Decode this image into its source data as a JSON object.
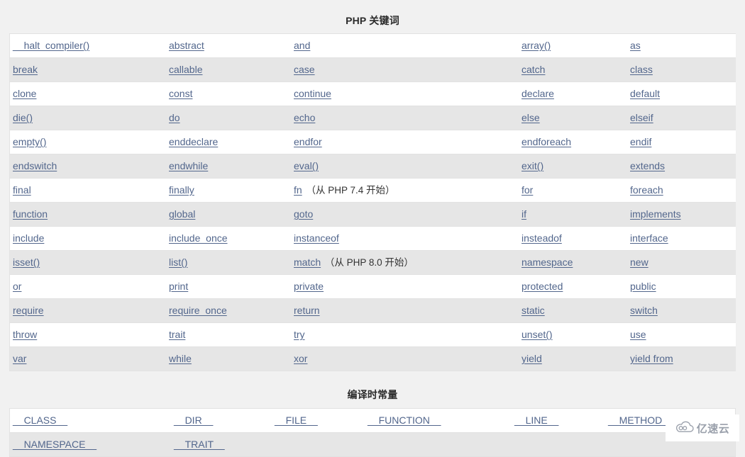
{
  "page": {
    "background_color": "#f1f1f1",
    "link_color": "#52668c",
    "alt_row_color": "#e6e6e6",
    "row_color": "#ffffff",
    "border_color": "#e2e2e2"
  },
  "keywords_section": {
    "title": "PHP 关键词",
    "rows": [
      [
        {
          "label": "__halt_compiler()",
          "note": ""
        },
        {
          "label": "abstract",
          "note": ""
        },
        {
          "label": "and",
          "note": ""
        },
        {
          "label": "array()",
          "note": ""
        },
        {
          "label": "as",
          "note": ""
        }
      ],
      [
        {
          "label": "break",
          "note": ""
        },
        {
          "label": "callable",
          "note": ""
        },
        {
          "label": "case",
          "note": ""
        },
        {
          "label": "catch",
          "note": ""
        },
        {
          "label": "class",
          "note": ""
        }
      ],
      [
        {
          "label": "clone",
          "note": ""
        },
        {
          "label": "const",
          "note": ""
        },
        {
          "label": "continue",
          "note": ""
        },
        {
          "label": "declare",
          "note": ""
        },
        {
          "label": "default",
          "note": ""
        }
      ],
      [
        {
          "label": "die()",
          "note": ""
        },
        {
          "label": "do",
          "note": ""
        },
        {
          "label": "echo",
          "note": ""
        },
        {
          "label": "else",
          "note": ""
        },
        {
          "label": "elseif",
          "note": ""
        }
      ],
      [
        {
          "label": "empty()",
          "note": ""
        },
        {
          "label": "enddeclare",
          "note": ""
        },
        {
          "label": "endfor",
          "note": ""
        },
        {
          "label": "endforeach",
          "note": ""
        },
        {
          "label": "endif",
          "note": ""
        }
      ],
      [
        {
          "label": "endswitch",
          "note": ""
        },
        {
          "label": "endwhile",
          "note": ""
        },
        {
          "label": "eval()",
          "note": ""
        },
        {
          "label": "exit()",
          "note": ""
        },
        {
          "label": "extends",
          "note": ""
        }
      ],
      [
        {
          "label": "final",
          "note": ""
        },
        {
          "label": "finally",
          "note": ""
        },
        {
          "label": "fn",
          "note": "（从 PHP 7.4 开始）"
        },
        {
          "label": "for",
          "note": ""
        },
        {
          "label": "foreach",
          "note": ""
        }
      ],
      [
        {
          "label": "function",
          "note": ""
        },
        {
          "label": "global",
          "note": ""
        },
        {
          "label": "goto",
          "note": ""
        },
        {
          "label": "if",
          "note": ""
        },
        {
          "label": "implements",
          "note": ""
        }
      ],
      [
        {
          "label": "include",
          "note": ""
        },
        {
          "label": "include_once",
          "note": ""
        },
        {
          "label": "instanceof",
          "note": ""
        },
        {
          "label": "insteadof",
          "note": ""
        },
        {
          "label": "interface",
          "note": ""
        }
      ],
      [
        {
          "label": "isset()",
          "note": ""
        },
        {
          "label": "list()",
          "note": ""
        },
        {
          "label": "match",
          "note": "（从 PHP 8.0 开始）"
        },
        {
          "label": "namespace",
          "note": ""
        },
        {
          "label": "new",
          "note": ""
        }
      ],
      [
        {
          "label": "or",
          "note": ""
        },
        {
          "label": "print",
          "note": ""
        },
        {
          "label": "private",
          "note": ""
        },
        {
          "label": "protected",
          "note": ""
        },
        {
          "label": "public",
          "note": ""
        }
      ],
      [
        {
          "label": "require",
          "note": ""
        },
        {
          "label": "require_once",
          "note": ""
        },
        {
          "label": "return",
          "note": ""
        },
        {
          "label": "static",
          "note": ""
        },
        {
          "label": "switch",
          "note": ""
        }
      ],
      [
        {
          "label": "throw",
          "note": ""
        },
        {
          "label": "trait",
          "note": ""
        },
        {
          "label": "try",
          "note": ""
        },
        {
          "label": "unset()",
          "note": ""
        },
        {
          "label": "use",
          "note": ""
        }
      ],
      [
        {
          "label": "var",
          "note": ""
        },
        {
          "label": "while",
          "note": ""
        },
        {
          "label": "xor",
          "note": ""
        },
        {
          "label": "yield",
          "note": ""
        },
        {
          "label": "yield from",
          "note": ""
        }
      ]
    ]
  },
  "constants_section": {
    "title": "编译时常量",
    "rows": [
      [
        {
          "label": "__CLASS__",
          "note": ""
        },
        {
          "label": "__DIR__",
          "note": ""
        },
        {
          "label": "__FILE__",
          "note": ""
        },
        {
          "label": "__FUNCTION__",
          "note": ""
        },
        {
          "label": "__LINE__",
          "note": ""
        },
        {
          "label": "__METHOD__",
          "note": ""
        }
      ],
      [
        {
          "label": "__NAMESPACE__",
          "note": ""
        },
        {
          "label": "__TRAIT__",
          "note": ""
        },
        {
          "label": "",
          "note": ""
        },
        {
          "label": "",
          "note": ""
        },
        {
          "label": "",
          "note": ""
        },
        {
          "label": "",
          "note": ""
        }
      ]
    ]
  },
  "watermark": {
    "text": "亿速云",
    "icon": "cloud-icon"
  }
}
